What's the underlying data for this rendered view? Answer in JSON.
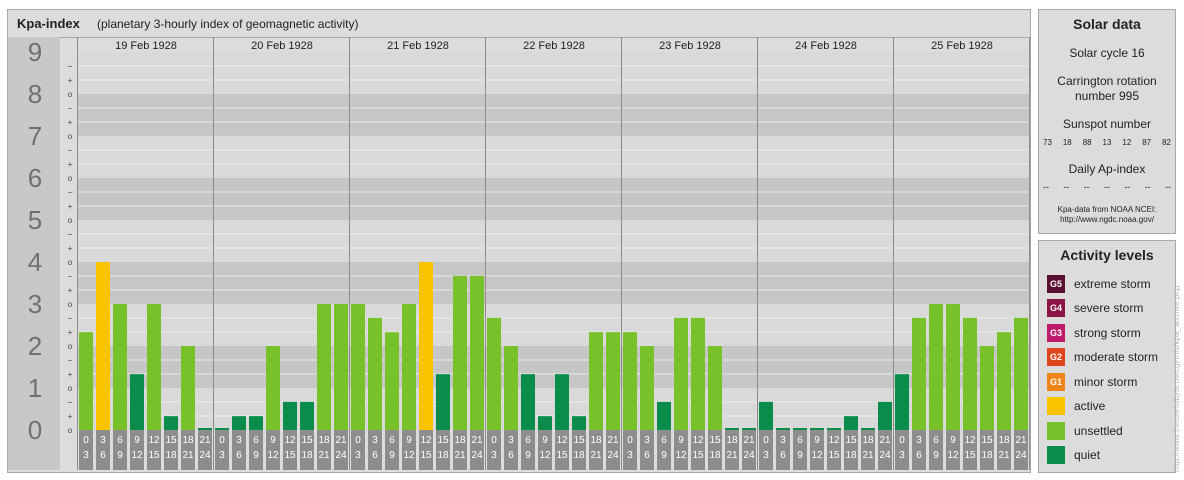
{
  "header": {
    "title": "Kpa-index",
    "subtitle": "(planetary 3-hourly index of geomagnetic activity)"
  },
  "chart_data": {
    "type": "bar",
    "ylim": [
      0,
      9
    ],
    "y_ticks": [
      "0",
      "1",
      "2",
      "3",
      "4",
      "5",
      "6",
      "7",
      "8",
      "9"
    ],
    "minor_ticks": [
      "o",
      "+",
      "−"
    ],
    "days": [
      "19 Feb 1928",
      "20 Feb 1928",
      "21 Feb 1928",
      "22 Feb 1928",
      "23 Feb 1928",
      "24 Feb 1928",
      "25 Feb 1928"
    ],
    "interval_labels": [
      [
        "0",
        "3"
      ],
      [
        "3",
        "6"
      ],
      [
        "6",
        "9"
      ],
      [
        "9",
        "12"
      ],
      [
        "12",
        "15"
      ],
      [
        "15",
        "18"
      ],
      [
        "18",
        "21"
      ],
      [
        "21",
        "24"
      ]
    ],
    "series": [
      {
        "values": [
          2.33,
          4.0,
          3.0,
          1.33,
          3.0,
          0.33,
          2.0,
          0.0,
          0.0,
          0.33,
          0.33,
          2.0,
          0.67,
          0.67,
          3.0,
          3.0,
          3.0,
          2.67,
          2.33,
          3.0,
          4.0,
          1.33,
          3.67,
          3.67,
          2.67,
          2.0,
          1.33,
          0.33,
          1.33,
          0.33,
          2.33,
          2.33,
          2.33,
          2.0,
          0.67,
          2.67,
          2.67,
          2.0,
          0.0,
          0.0,
          0.67,
          0.0,
          0.0,
          0.0,
          0.0,
          0.33,
          0.0,
          0.67,
          1.33,
          2.67,
          3.0,
          3.0,
          2.67,
          2.0,
          2.33,
          2.67
        ]
      }
    ],
    "colors": {
      "quiet": "#0a8c4a",
      "unsettled": "#77c22a",
      "active": "#f8c400"
    },
    "grid": true
  },
  "solar": {
    "title": "Solar data",
    "cycle": "Solar cycle 16",
    "carrington_1": "Carrington rotation",
    "carrington_2": "number 995",
    "sunspot_label": "Sunspot number",
    "sunspot_values": [
      "73",
      "18",
      "88",
      "13",
      "12",
      "87",
      "82"
    ],
    "ap_label": "Daily Ap-index",
    "ap_values": [
      "--",
      "--",
      "--",
      "--",
      "--",
      "--",
      "--"
    ],
    "source_1": "Kpa-data from NOAA NCEI:",
    "source_2": "http://www.ngdc.noaa.gov/"
  },
  "levels": {
    "title": "Activity levels",
    "items": [
      {
        "badge": "G5",
        "label": "extreme storm",
        "color": "#5a0f33"
      },
      {
        "badge": "G4",
        "label": "severe storm",
        "color": "#8a1546"
      },
      {
        "badge": "G3",
        "label": "strong storm",
        "color": "#bd1a6a"
      },
      {
        "badge": "G2",
        "label": "moderate storm",
        "color": "#e0461c"
      },
      {
        "badge": "G1",
        "label": "minor storm",
        "color": "#ef8419"
      },
      {
        "badge": "",
        "label": "active",
        "color": "#f8c400"
      },
      {
        "badge": "",
        "label": "unsettled",
        "color": "#77c22a"
      },
      {
        "badge": "",
        "label": "quiet",
        "color": "#0a8c4a"
      }
    ]
  },
  "watermark": "http://www.theusefulbyte.de/cgi/mfs/kpa_archive.php"
}
